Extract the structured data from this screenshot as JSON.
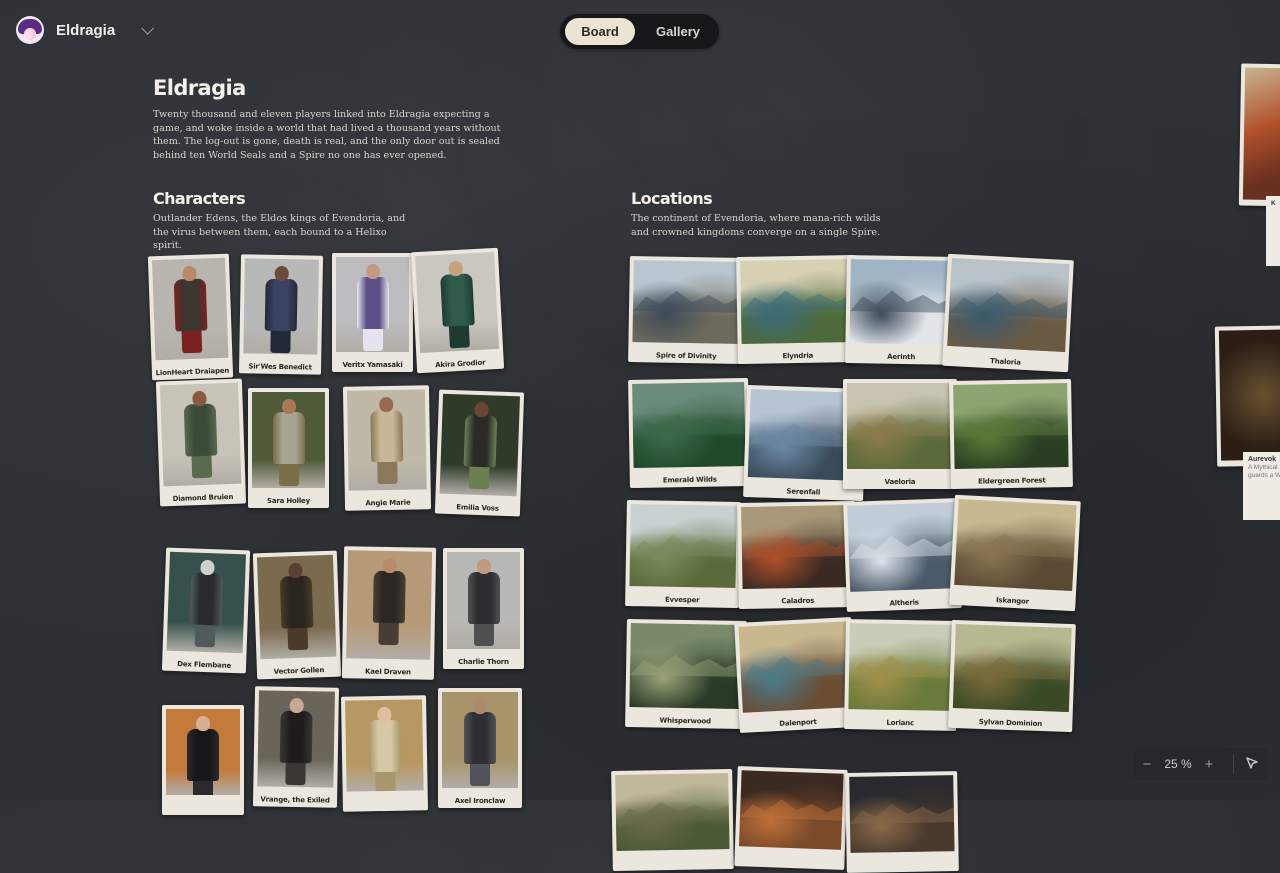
{
  "app": {
    "name": "Eldragia"
  },
  "view_toggle": {
    "board": "Board",
    "gallery": "Gallery",
    "active": "Board"
  },
  "board": {
    "title": "Eldragia",
    "description": "Twenty thousand and eleven players linked into Eldragia expecting a game, and woke inside a world that had lived a thousand years without them. The log-out is gone, death is real, and the only door out is sealed behind ten World Seals and a Spire no one has ever opened."
  },
  "characters": {
    "title": "Characters",
    "description": "Outlander Edens, the Eldos kings of Evendoria, and the virus between them, each bound to a Helixo spirit.",
    "items": [
      {
        "name": "LionHeart Draiapen",
        "bg": "#b8b5ae",
        "cloth": "#3a3630",
        "accent": "#7a2023",
        "skin": "#b88a6a"
      },
      {
        "name": "Sir'Wes Benedict",
        "bg": "#b7b8b8",
        "cloth": "#3b4160",
        "accent": "#232838",
        "skin": "#6a4a38"
      },
      {
        "name": "Veritx Yamasaki",
        "bg": "#bcbbbd",
        "cloth": "#5b4f86",
        "accent": "#e5e3ee",
        "skin": "#c59a80"
      },
      {
        "name": "Akira Grodior",
        "bg": "#c9c7c0",
        "cloth": "#2f5a4c",
        "accent": "#1e3b33",
        "skin": "#c8a27f"
      },
      {
        "name": "Diamond Bruien",
        "bg": "#c8c3b8",
        "cloth": "#3c4a3a",
        "accent": "#5a6a4e",
        "skin": "#8a5a40"
      },
      {
        "name": "Sara Holley",
        "bg": "#4e5a38",
        "cloth": "#a8a494",
        "accent": "#7a6e48",
        "skin": "#a8785a"
      },
      {
        "name": "Angie Marie",
        "bg": "#c0b9a8",
        "cloth": "#c7b998",
        "accent": "#8a7858",
        "skin": "#9a6a4e"
      },
      {
        "name": "Emilia Voss",
        "bg": "#2f3a28",
        "cloth": "#2b2a26",
        "accent": "#6a8050",
        "skin": "#6a4632"
      },
      {
        "name": "Dex Flembane",
        "bg": "#36504c",
        "cloth": "#2b2b2e",
        "accent": "#505a5a",
        "skin": "#cfcfcf"
      },
      {
        "name": "Vector Gollen",
        "bg": "#7a6a4e",
        "cloth": "#2b2520",
        "accent": "#4a3a2a",
        "skin": "#5a4030"
      },
      {
        "name": "Kael Draven",
        "bg": "#b69a78",
        "cloth": "#2b2723",
        "accent": "#4a3e34",
        "skin": "#b88a6a"
      },
      {
        "name": "Charlie Thorn",
        "bg": "#b8b8b6",
        "cloth": "#2e2e30",
        "accent": "#505052",
        "skin": "#c09a80"
      },
      {
        "name": "",
        "bg": "#c47a3a",
        "cloth": "#17171a",
        "accent": "#2a2a2e",
        "skin": "#d8b094"
      },
      {
        "name": "Vrange, the Exiled",
        "bg": "#6a645a",
        "cloth": "#1f1d1b",
        "accent": "#3a3632",
        "skin": "#c8a890"
      },
      {
        "name": "",
        "bg": "#b89862",
        "cloth": "#d6c8a4",
        "accent": "#a8966c",
        "skin": "#e0bea0"
      },
      {
        "name": "Axel Ironclaw",
        "bg": "#a8946a",
        "cloth": "#2e3034",
        "accent": "#50545a",
        "skin": "#b08a6a"
      }
    ]
  },
  "locations": {
    "title": "Locations",
    "description": "The continent of Evendoria, where mana-rich wilds and crowned kingdoms converge on a single Spire.",
    "items": [
      {
        "name": "Spire of Divinity",
        "sky": "#b9c6cf",
        "land": "#6d6a5c",
        "accent": "#3d4a58"
      },
      {
        "name": "Elyndria",
        "sky": "#d7d0b2",
        "land": "#4e6a3a",
        "accent": "#3a6a7a"
      },
      {
        "name": "Aerinth",
        "sky": "#9fb4c4",
        "land": "#e2e6ea",
        "accent": "#3b4a5a"
      },
      {
        "name": "Thaloria",
        "sky": "#b8c2c8",
        "land": "#6a5a44",
        "accent": "#3a5a6e"
      },
      {
        "name": "Emerald Wilds",
        "sky": "#6a8a7a",
        "land": "#1f4a2a",
        "accent": "#3a6a4a"
      },
      {
        "name": "Serenfall",
        "sky": "#b6c4d4",
        "land": "#3a4a5a",
        "accent": "#6a8aa4"
      },
      {
        "name": "Vaeloria",
        "sky": "#c8c4b0",
        "land": "#5a6a3a",
        "accent": "#8a7a4a"
      },
      {
        "name": "Eldergreen Forest",
        "sky": "#8ea470",
        "land": "#2a3e22",
        "accent": "#5a7a38"
      },
      {
        "name": "Evvesper",
        "sky": "#c8d0d0",
        "land": "#5a6a3a",
        "accent": "#7a8a5a"
      },
      {
        "name": "Caladros",
        "sky": "#a89878",
        "land": "#3a2a22",
        "accent": "#b0502a"
      },
      {
        "name": "Altheris",
        "sky": "#c0ccd8",
        "land": "#4a5a6a",
        "accent": "#e0e4ea"
      },
      {
        "name": "Iskangor",
        "sky": "#c8b890",
        "land": "#5a4a34",
        "accent": "#8a7450"
      },
      {
        "name": "Whisperwood",
        "sky": "#7a8a6a",
        "land": "#2a3a26",
        "accent": "#9aa47a"
      },
      {
        "name": "Dalenport",
        "sky": "#c8b890",
        "land": "#6a4e34",
        "accent": "#4a7a8a"
      },
      {
        "name": "Lorianc",
        "sky": "#c8ccb8",
        "land": "#6a7a3a",
        "accent": "#a0904a"
      },
      {
        "name": "Sylvan Dominion",
        "sky": "#b8b890",
        "land": "#3a4a26",
        "accent": "#7a6a3a"
      },
      {
        "name": "",
        "sky": "#c0b89a",
        "land": "#4a5a34",
        "accent": "#6a6a48"
      },
      {
        "name": "",
        "sky": "#3a2a22",
        "land": "#7a4a2a",
        "accent": "#c0703a"
      },
      {
        "name": "",
        "sky": "#2a2a2e",
        "land": "#4a3a2e",
        "accent": "#8a6a4a"
      }
    ]
  },
  "side_cards": {
    "aurevok": {
      "title": "Aurevok",
      "text": "A Mythical ... guards a W..."
    },
    "partial_title": "K"
  },
  "zoom": {
    "minus": "−",
    "value": "25 %",
    "plus": "+"
  }
}
